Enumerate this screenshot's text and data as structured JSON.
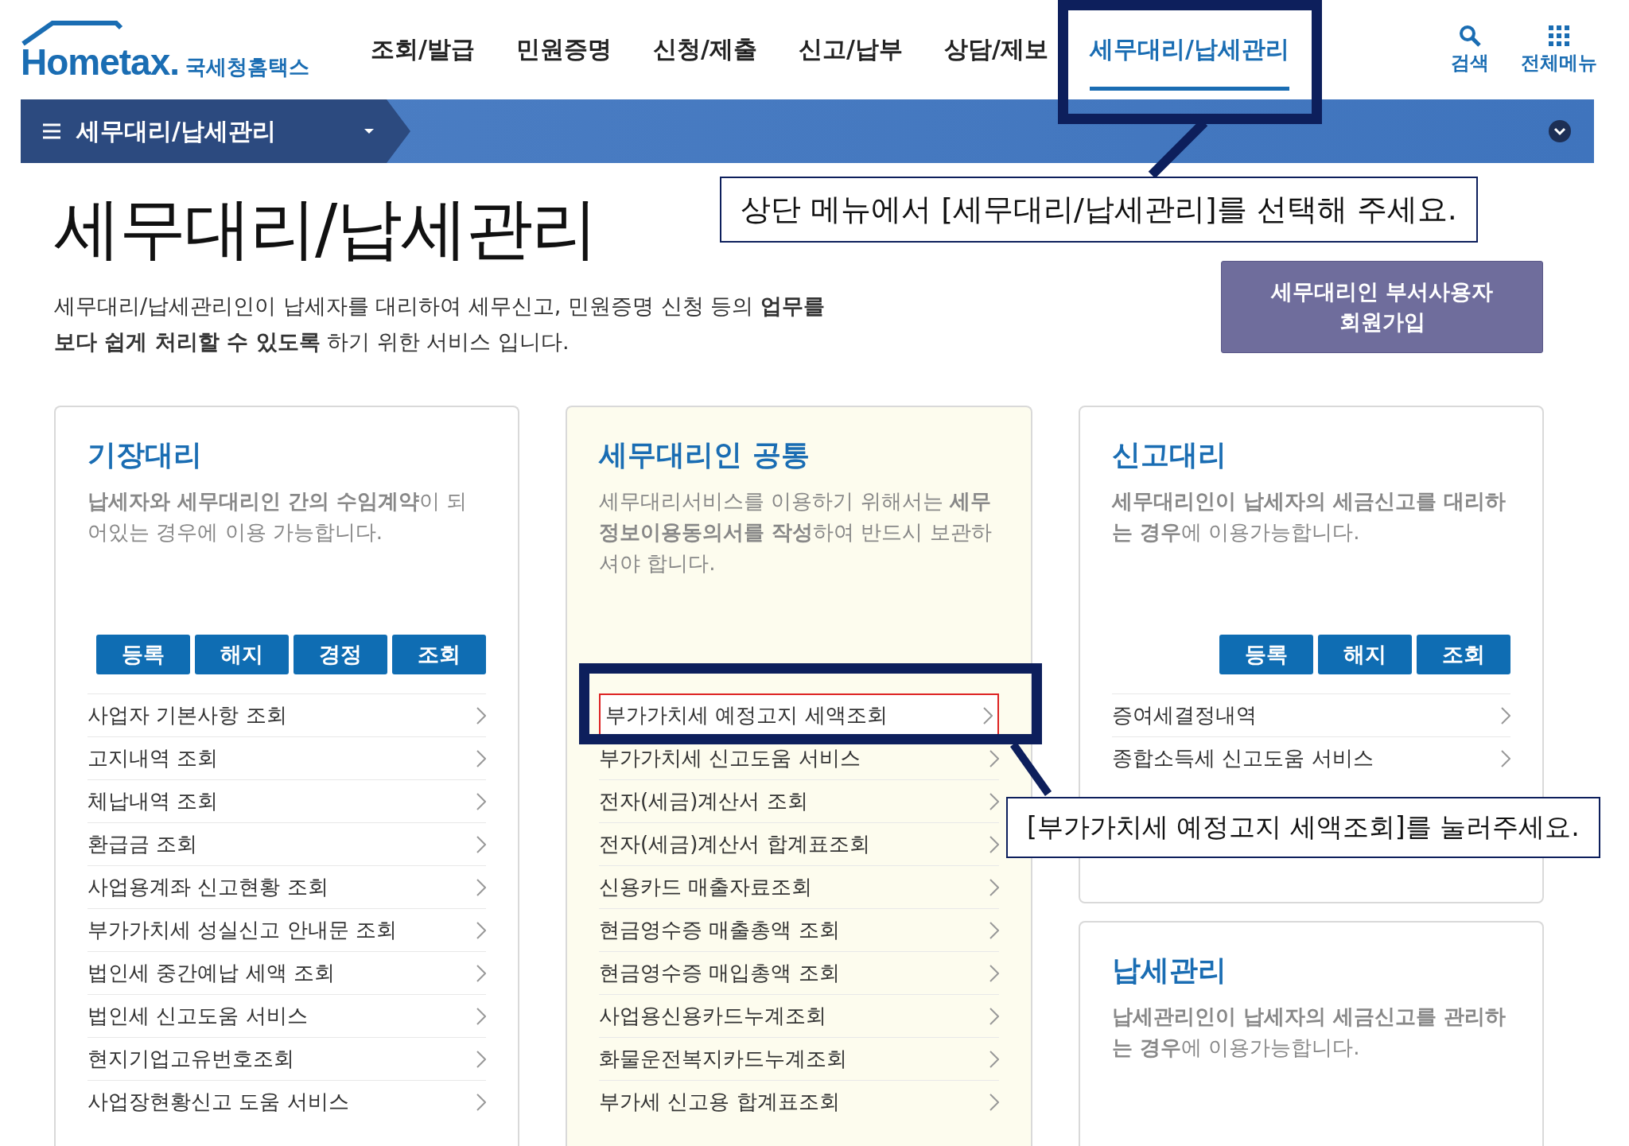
{
  "header": {
    "logo": {
      "wordmark": "Hometax.",
      "name": "국세청홈택스"
    },
    "nav": [
      {
        "label": "조회/발급",
        "selected": false
      },
      {
        "label": "민원증명",
        "selected": false
      },
      {
        "label": "신청/제출",
        "selected": false
      },
      {
        "label": "신고/납부",
        "selected": false
      },
      {
        "label": "상담/제보",
        "selected": false
      },
      {
        "label": "세무대리/납세관리",
        "selected": true
      }
    ],
    "tools": [
      {
        "kind": "search",
        "label": "검색"
      },
      {
        "kind": "menu",
        "label": "전체메뉴"
      }
    ]
  },
  "subbar": {
    "title": "세무대리/납세관리"
  },
  "page": {
    "title": "세무대리/납세관리",
    "description": "세무대리/납세관리인이 납세자를 대리하여 세무신고, 민원증명 신청 등의 **업무를 보다 쉽게 처리할 수 있도록** 하기 위한 서비스 입니다.",
    "join_button": [
      "세무대리인 부서사용자",
      "회원가입"
    ]
  },
  "cards": [
    {
      "title": "기장대리",
      "tinted": false,
      "description": "**납세자와 세무대리인 간의 수임계약**이 되어있는 경우에 이용 가능합니다.",
      "buttons": [
        "등록",
        "해지",
        "경정",
        "조회"
      ],
      "items": [
        {
          "label": "사업자 기본사항 조회",
          "highlighted": false
        },
        {
          "label": "고지내역 조회",
          "highlighted": false
        },
        {
          "label": "체납내역 조회",
          "highlighted": false
        },
        {
          "label": "환급금 조회",
          "highlighted": false
        },
        {
          "label": "사업용계좌 신고현황 조회",
          "highlighted": false
        },
        {
          "label": "부가가치세 성실신고 안내문 조회",
          "highlighted": false
        },
        {
          "label": "법인세 중간예납 세액 조회",
          "highlighted": false
        },
        {
          "label": "법인세 신고도움 서비스",
          "highlighted": false
        },
        {
          "label": "현지기업고유번호조회",
          "highlighted": false
        },
        {
          "label": "사업장현황신고 도움 서비스",
          "highlighted": false
        }
      ]
    },
    {
      "title": "세무대리인 공통",
      "tinted": true,
      "description": "세무대리서비스를 이용하기 위해서는 **세무정보이용동의서를 작성**하여 반드시 보관하셔야 합니다.",
      "items": [
        {
          "label": "부가가치세 예정고지 세액조회",
          "highlighted": true
        },
        {
          "label": "부가가치세 신고도움 서비스",
          "highlighted": false
        },
        {
          "label": "전자(세금)계산서 조회",
          "highlighted": false
        },
        {
          "label": "전자(세금)계산서 합계표조회",
          "highlighted": false
        },
        {
          "label": "신용카드 매출자료조회",
          "highlighted": false
        },
        {
          "label": "현금영수증 매출총액 조회",
          "highlighted": false
        },
        {
          "label": "현금영수증 매입총액 조회",
          "highlighted": false
        },
        {
          "label": "사업용신용카드누계조회",
          "highlighted": false
        },
        {
          "label": "화물운전복지카드누계조회",
          "highlighted": false
        },
        {
          "label": "부가세 신고용 합계표조회",
          "highlighted": false
        }
      ]
    },
    {
      "title": "신고대리",
      "tinted": false,
      "description": "**세무대리인이 납세자의 세금신고를 대리하는 경우**에 이용가능합니다.",
      "buttons": [
        "등록",
        "해지",
        "조회"
      ],
      "items": [
        {
          "label": "증여세결정내역",
          "highlighted": false
        },
        {
          "label": "종합소득세 신고도움 서비스",
          "highlighted": false
        }
      ]
    },
    {
      "title": "납세관리",
      "tinted": false,
      "description": "**납세관리인이 납세자의 세금신고를 관리하는 경우**에 이용가능합니다."
    }
  ],
  "callouts": [
    {
      "kind": "nav",
      "text": "상단 메뉴에서 [세무대리/납세관리]를 선택해 주세요."
    },
    {
      "kind": "item",
      "text": "[부가가치세 예정고지 세액조회]를 눌러주세요."
    }
  ]
}
